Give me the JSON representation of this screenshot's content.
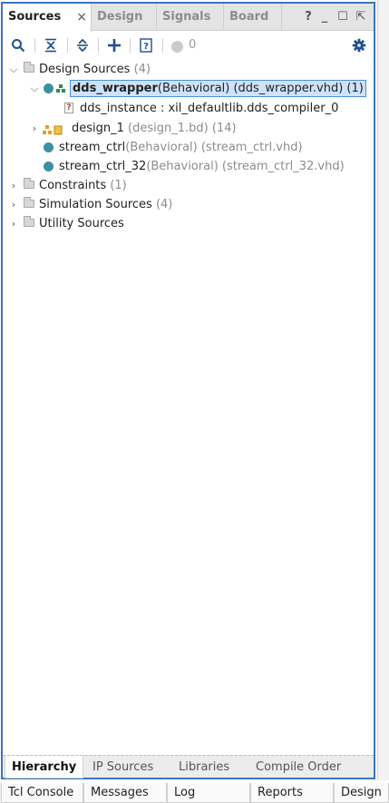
{
  "tabs": [
    {
      "label": "Sources"
    },
    {
      "label": "Design"
    },
    {
      "label": "Signals"
    },
    {
      "label": "Board"
    }
  ],
  "close_glyph": "×",
  "window_controls": {
    "help": "?",
    "minimize": "_",
    "maximize": "☐",
    "float": "⇱"
  },
  "toolbar": {
    "message_count": "0"
  },
  "tree": {
    "design_sources": {
      "label": "Design Sources",
      "count": "(4)"
    },
    "dds_wrapper": {
      "name": "dds_wrapper",
      "detail": "(Behavioral) (dds_wrapper.vhd) (1)"
    },
    "dds_instance": {
      "label": "dds_instance : xil_defaultlib.dds_compiler_0"
    },
    "design_1": {
      "name": "design_1",
      "detail": "(design_1.bd) (14)"
    },
    "stream_ctrl": {
      "name": "stream_ctrl",
      "detail": "(Behavioral) (stream_ctrl.vhd)"
    },
    "stream_ctrl_32": {
      "name": "stream_ctrl_32",
      "detail": "(Behavioral) (stream_ctrl_32.vhd)"
    },
    "constraints": {
      "label": "Constraints",
      "count": "(1)"
    },
    "simulation_sources": {
      "label": "Simulation Sources",
      "count": "(4)"
    },
    "utility_sources": {
      "label": "Utility Sources"
    }
  },
  "bottom_tabs": [
    "Hierarchy",
    "IP Sources",
    "Libraries",
    "Compile Order"
  ],
  "window_tabs": [
    "Tcl Console",
    "Messages",
    "Log",
    "Reports",
    "Design R"
  ],
  "colors": {
    "accent": "#3b73c4",
    "selection": "#cfe2fb",
    "status_dot": "#3d8ea6"
  }
}
